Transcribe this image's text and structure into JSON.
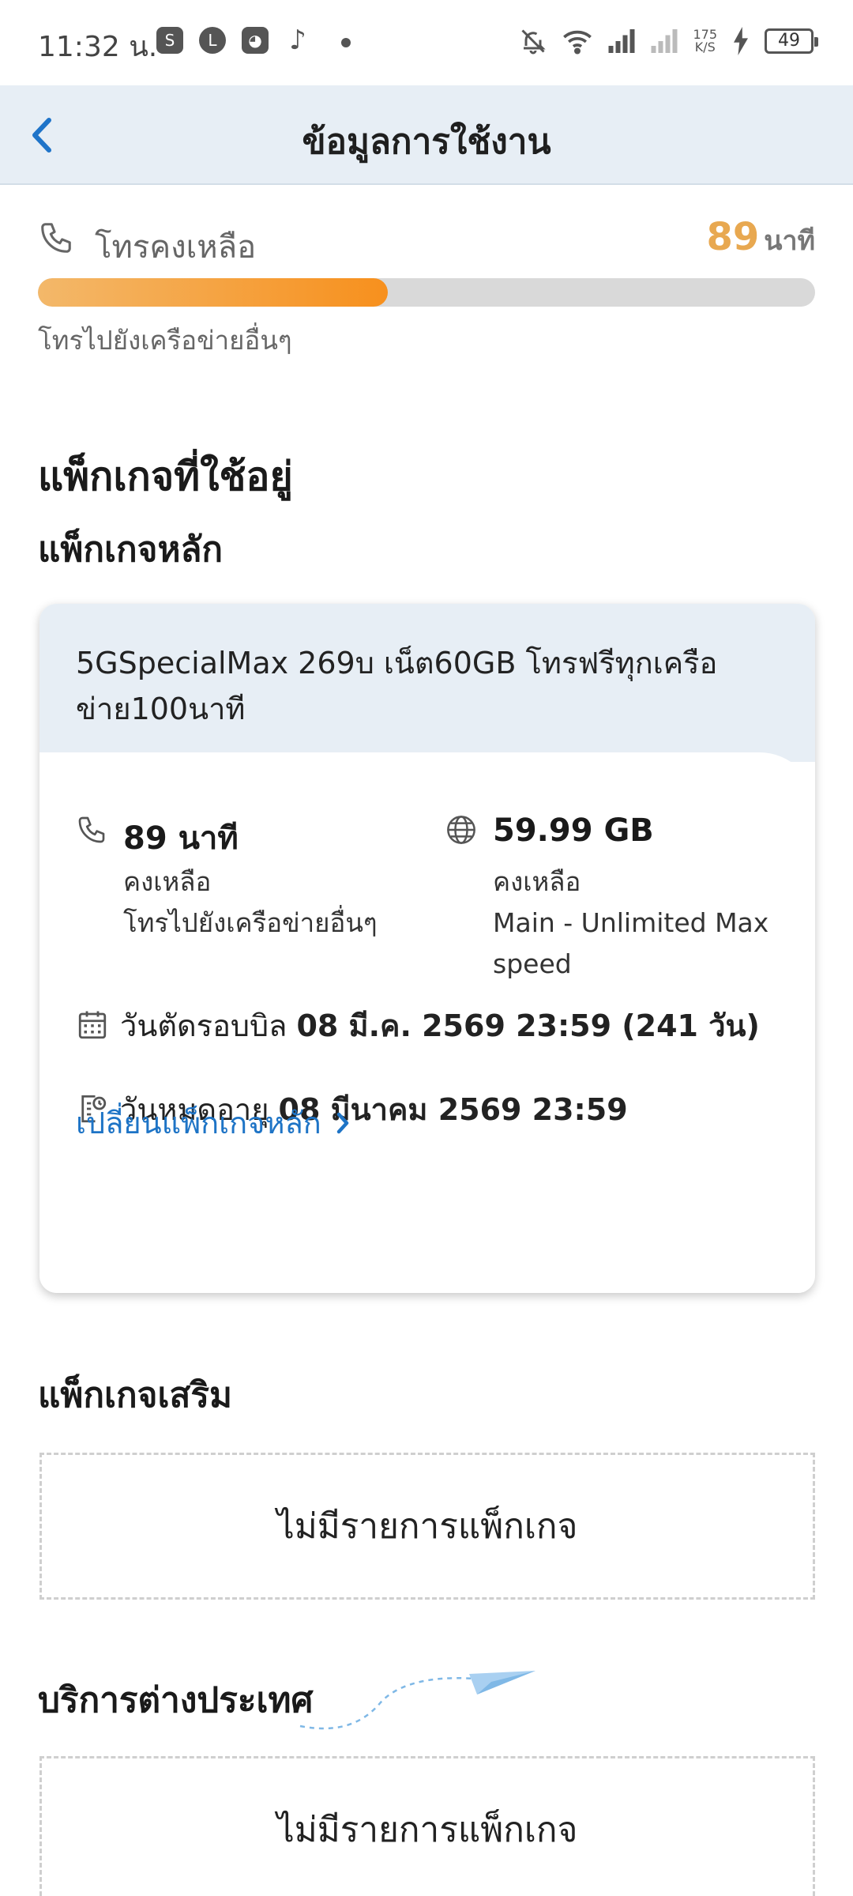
{
  "status_bar": {
    "time": "11:32 น.",
    "net_speed_value": "175",
    "net_speed_unit": "K/S",
    "battery": "49",
    "app_icons": [
      "shopee-icon",
      "line-icon",
      "cat-app-icon",
      "tiktok-icon"
    ]
  },
  "header": {
    "title": "ข้อมูลการใช้งาน"
  },
  "call_remaining": {
    "label": "โทรคงเหลือ",
    "value": "89",
    "unit": "นาที",
    "progress_fraction": 0.45,
    "subtitle": "โทรไปยังเครือข่ายอื่นๆ"
  },
  "current_packages": {
    "title": "แพ็กเกจที่ใช้อยู่",
    "main_title": "แพ็กเกจหลัก",
    "main_package": {
      "name": "5GSpecialMax 269บ เน็ต60GB โทรฟรีทุกเครือข่าย100นาที",
      "voice": {
        "value": "89 นาที",
        "line1": "คงเหลือ",
        "line2": "โทรไปยังเครือข่ายอื่นๆ"
      },
      "data": {
        "value": "59.99 GB",
        "line1": "คงเหลือ",
        "line2": "Main - Unlimited Max speed"
      },
      "billing_label": "วันตัดรอบบิล",
      "billing_value": "08 มี.ค. 2569 23:59 (241 วัน)",
      "expiry_label": "วันหมดอายุ",
      "expiry_value": "08 มีนาคม 2569 23:59",
      "change_link": "เปลี่ยนแพ็กเกจหลัก"
    }
  },
  "addon": {
    "title": "แพ็กเกจเสริม",
    "empty_text": "ไม่มีรายการแพ็กเกจ"
  },
  "international": {
    "title": "บริการต่างประเทศ",
    "empty_text": "ไม่มีรายการแพ็กเกจ"
  },
  "colors": {
    "accent_blue": "#1f74c9",
    "orange": "#f7901d",
    "header_bg": "#e7eef5"
  }
}
